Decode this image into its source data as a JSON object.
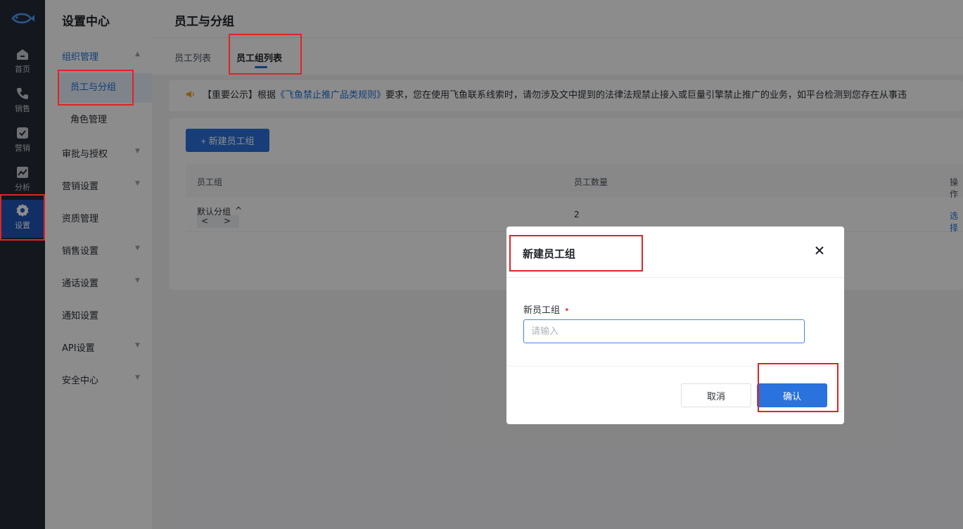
{
  "rail": {
    "items": [
      {
        "label": "首页",
        "icon": "home-icon"
      },
      {
        "label": "销售",
        "icon": "phone-icon"
      },
      {
        "label": "营销",
        "icon": "marketing-icon"
      },
      {
        "label": "分析",
        "icon": "chart-icon"
      },
      {
        "label": "设置",
        "icon": "gear-icon"
      }
    ]
  },
  "sidebar": {
    "title": "设置中心",
    "groups": [
      {
        "label": "组织管理"
      },
      {
        "label": "员工与分组"
      },
      {
        "label": "角色管理"
      },
      {
        "label": "审批与授权"
      },
      {
        "label": "营销设置"
      },
      {
        "label": "资质管理"
      },
      {
        "label": "销售设置"
      },
      {
        "label": "通话设置"
      },
      {
        "label": "通知设置"
      },
      {
        "label": "API设置"
      },
      {
        "label": "安全中心"
      }
    ]
  },
  "header": {
    "title": "员工与分组"
  },
  "tabs": [
    {
      "label": "员工列表"
    },
    {
      "label": "员工组列表"
    }
  ],
  "notice": {
    "prefix": "【重要公示】根据",
    "link": "《飞鱼禁止推广品类规则》",
    "suffix": "要求，您在使用飞鱼联系线索时，请勿涉及文中提到的法律法规禁止接入或巨量引擎禁止推广的业务，如平台检测到您存在从事违"
  },
  "card": {
    "new_button": "+ 新建员工组",
    "columns": [
      "员工组",
      "员工数量",
      "操作"
    ],
    "rows": [
      {
        "group": "默认分组",
        "count": "2",
        "action": "选择"
      }
    ],
    "row_ctrl": {
      "up": "^",
      "left": "<",
      "right": ">"
    }
  },
  "modal": {
    "title": "新建员工组",
    "field_label": "新员工组",
    "required_mark": "•",
    "placeholder": "请输入",
    "cancel": "取消",
    "confirm": "确认"
  },
  "colors": {
    "accent": "#2a72dd",
    "rail_bg": "#262b38",
    "annotation": "#e02424"
  }
}
